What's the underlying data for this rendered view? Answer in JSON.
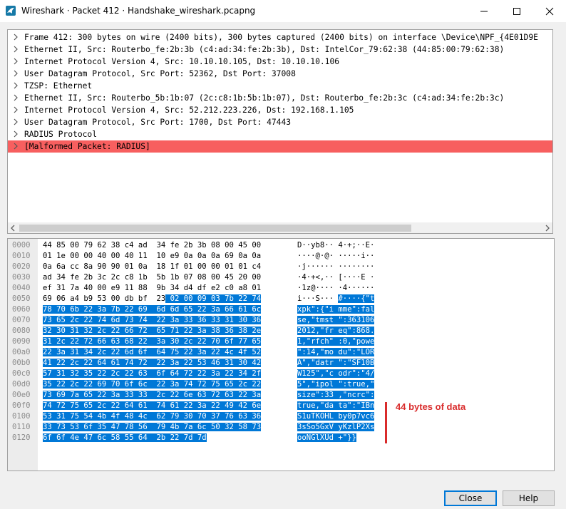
{
  "window": {
    "title": "Wireshark · Packet 412 · Handshake_wireshark.pcapng"
  },
  "tree": [
    "Frame 412: 300 bytes on wire (2400 bits), 300 bytes captured (2400 bits) on interface \\Device\\NPF_{4E01D9E",
    "Ethernet II, Src: Routerbo_fe:2b:3b (c4:ad:34:fe:2b:3b), Dst: IntelCor_79:62:38 (44:85:00:79:62:38)",
    "Internet Protocol Version 4, Src: 10.10.10.105, Dst: 10.10.10.106",
    "User Datagram Protocol, Src Port: 52362, Dst Port: 37008",
    "TZSP: Ethernet",
    "Ethernet II, Src: Routerbo_5b:1b:07 (2c:c8:1b:5b:1b:07), Dst: Routerbo_fe:2b:3c (c4:ad:34:fe:2b:3c)",
    "Internet Protocol Version 4, Src: 52.212.223.226, Dst: 192.168.1.105",
    "User Datagram Protocol, Src Port: 1700, Dst Port: 47443",
    "RADIUS Protocol",
    "[Malformed Packet: RADIUS]"
  ],
  "hex": [
    {
      "off": "0000",
      "bytes": "44 85 00 79 62 38 c4 ad  34 fe 2b 3b 08 00 45 00",
      "ascii": "D··yb8·· 4·+;··E·"
    },
    {
      "off": "0010",
      "bytes": "01 1e 00 00 40 00 40 11  10 e9 0a 0a 0a 69 0a 0a",
      "ascii": "····@·@· ·····i··"
    },
    {
      "off": "0020",
      "bytes": "0a 6a cc 8a 90 90 01 0a  18 1f 01 00 00 01 01 c4",
      "ascii": "·j······ ········"
    },
    {
      "off": "0030",
      "bytes": "ad 34 fe 2b 3c 2c c8 1b  5b 1b 07 08 00 45 20 00",
      "ascii": "·4·+<,·· [····E ·"
    },
    {
      "off": "0040",
      "bytes": "ef 31 7a 40 00 e9 11 88  9b 34 d4 df e2 c0 a8 01",
      "ascii": "·1z@···· ·4······"
    },
    {
      "off": "0050",
      "bytes": "69 06 a4 b9 53 00 db bf  23 02 00 09 03 7b 22 74",
      "ascii": "i···S··· #····{\"t",
      "hl_hex": 27,
      "hl_asc": 9
    },
    {
      "off": "0060",
      "bytes": "78 70 6b 22 3a 7b 22 69  6d 6d 65 22 3a 66 61 6c",
      "ascii": "xpk\":{\"i mme\":fal",
      "hl_hex": 0,
      "hl_asc": 0
    },
    {
      "off": "0070",
      "bytes": "73 65 2c 22 74 6d 73 74  22 3a 33 36 33 31 30 36",
      "ascii": "se,\"tmst \":363106",
      "hl_hex": 0,
      "hl_asc": 0
    },
    {
      "off": "0080",
      "bytes": "32 30 31 32 2c 22 66 72  65 71 22 3a 38 36 38 2e",
      "ascii": "2012,\"fr eq\":868.",
      "hl_hex": 0,
      "hl_asc": 0
    },
    {
      "off": "0090",
      "bytes": "31 2c 22 72 66 63 68 22  3a 30 2c 22 70 6f 77 65",
      "ascii": "1,\"rfch\" :0,\"powe",
      "hl_hex": 0,
      "hl_asc": 0
    },
    {
      "off": "00a0",
      "bytes": "22 3a 31 34 2c 22 6d 6f  64 75 22 3a 22 4c 4f 52",
      "ascii": "\":14,\"mo du\":\"LOR",
      "hl_hex": 0,
      "hl_asc": 0
    },
    {
      "off": "00b0",
      "bytes": "41 22 2c 22 64 61 74 72  22 3a 22 53 46 31 30 42",
      "ascii": "A\",\"datr \":\"SF10B",
      "hl_hex": 0,
      "hl_asc": 0
    },
    {
      "off": "00c0",
      "bytes": "57 31 32 35 22 2c 22 63  6f 64 72 22 3a 22 34 2f",
      "ascii": "W125\",\"c odr\":\"4/",
      "hl_hex": 0,
      "hl_asc": 0
    },
    {
      "off": "00d0",
      "bytes": "35 22 2c 22 69 70 6f 6c  22 3a 74 72 75 65 2c 22",
      "ascii": "5\",\"ipol \":true,\"",
      "hl_hex": 0,
      "hl_asc": 0
    },
    {
      "off": "00e0",
      "bytes": "73 69 7a 65 22 3a 33 33  2c 22 6e 63 72 63 22 3a",
      "ascii": "size\":33 ,\"ncrc\":",
      "hl_hex": 0,
      "hl_asc": 0
    },
    {
      "off": "00f0",
      "bytes": "74 72 75 65 2c 22 64 61  74 61 22 3a 22 49 42 6e",
      "ascii": "true,\"da ta\":\"IBn",
      "hl_hex": 0,
      "hl_asc": 0
    },
    {
      "off": "0100",
      "bytes": "53 31 75 54 4b 4f 48 4c  62 79 30 70 37 76 63 36",
      "ascii": "S1uTKOHL by0p7vc6",
      "hl_hex": 0,
      "hl_asc": 0
    },
    {
      "off": "0110",
      "bytes": "33 73 53 6f 35 47 78 56  79 4b 7a 6c 50 32 58 73",
      "ascii": "3sSo5GxV yKzlP2Xs",
      "hl_hex": 0,
      "hl_asc": 0
    },
    {
      "off": "0120",
      "bytes": "6f 6f 4e 47 6c 58 55 64  2b 22 7d 7d",
      "ascii": "ooNGlXUd +\"}}",
      "hl_hex": 0,
      "hl_asc": 0
    }
  ],
  "annotation": {
    "text": "44 bytes of data",
    "color": "#d92b2b"
  },
  "buttons": {
    "close": "Close",
    "help": "Help"
  },
  "colors": {
    "selection": "#0078d7",
    "malformed": "#f75f5f",
    "titlebar_bg": "#ffffff",
    "window_bg": "#f0f0f0"
  },
  "icons": {
    "app": "wireshark-fin-icon",
    "minimize": "minimize-icon",
    "maximize": "maximize-icon",
    "close": "close-icon",
    "expand": "chevron-right-icon"
  }
}
